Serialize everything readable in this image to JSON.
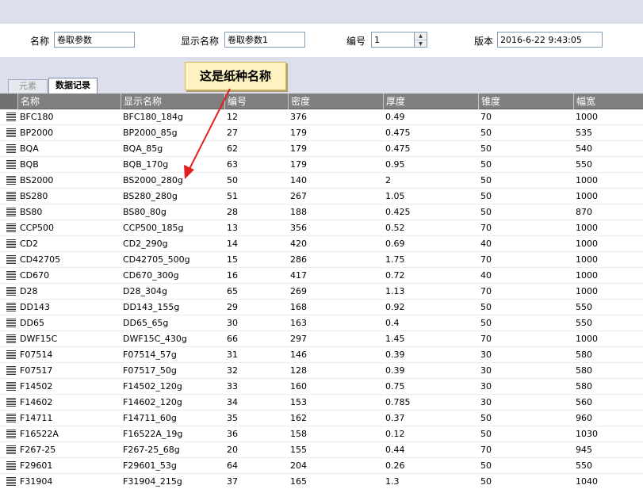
{
  "form": {
    "name_label": "名称",
    "name_value": "卷取参数",
    "display_name_label": "显示名称",
    "display_name_value": "卷取参数1",
    "number_label": "编号",
    "number_value": "1",
    "version_label": "版本",
    "version_value": "2016-6-22 9:43:05"
  },
  "tabs": [
    {
      "label": "元素"
    },
    {
      "label": "数据记录"
    }
  ],
  "callout": {
    "text": "这是纸种名称"
  },
  "grid": {
    "columns": [
      "名称",
      "显示名称",
      "编号",
      "密度",
      "厚度",
      "锥度",
      "幅宽"
    ],
    "rows": [
      {
        "cells": [
          "BFC180",
          "BFC180_184g",
          "12",
          "376",
          "0.49",
          "70",
          "1000"
        ]
      },
      {
        "cells": [
          "BP2000",
          "BP2000_85g",
          "27",
          "179",
          "0.475",
          "50",
          "535"
        ]
      },
      {
        "cells": [
          "BQA",
          "BQA_85g",
          "62",
          "179",
          "0.475",
          "50",
          "540"
        ]
      },
      {
        "cells": [
          "BQB",
          "BQB_170g",
          "63",
          "179",
          "0.95",
          "50",
          "550"
        ]
      },
      {
        "cells": [
          "BS2000",
          "BS2000_280g",
          "50",
          "140",
          "2",
          "50",
          "1000"
        ]
      },
      {
        "cells": [
          "BS280",
          "BS280_280g",
          "51",
          "267",
          "1.05",
          "50",
          "1000"
        ]
      },
      {
        "cells": [
          "BS80",
          "BS80_80g",
          "28",
          "188",
          "0.425",
          "50",
          "870"
        ]
      },
      {
        "cells": [
          "CCP500",
          "CCP500_185g",
          "13",
          "356",
          "0.52",
          "70",
          "1000"
        ]
      },
      {
        "cells": [
          "CD2",
          "CD2_290g",
          "14",
          "420",
          "0.69",
          "40",
          "1000"
        ]
      },
      {
        "cells": [
          "CD42705",
          "CD42705_500g",
          "15",
          "286",
          "1.75",
          "70",
          "1000"
        ]
      },
      {
        "cells": [
          "CD670",
          "CD670_300g",
          "16",
          "417",
          "0.72",
          "40",
          "1000"
        ]
      },
      {
        "cells": [
          "D28",
          "D28_304g",
          "65",
          "269",
          "1.13",
          "70",
          "1000"
        ]
      },
      {
        "cells": [
          "DD143",
          "DD143_155g",
          "29",
          "168",
          "0.92",
          "50",
          "550"
        ]
      },
      {
        "cells": [
          "DD65",
          "DD65_65g",
          "30",
          "163",
          "0.4",
          "50",
          "550"
        ]
      },
      {
        "cells": [
          "DWF15C",
          "DWF15C_430g",
          "66",
          "297",
          "1.45",
          "70",
          "1000"
        ]
      },
      {
        "cells": [
          "F07514",
          "F07514_57g",
          "31",
          "146",
          "0.39",
          "30",
          "580"
        ]
      },
      {
        "cells": [
          "F07517",
          "F07517_50g",
          "32",
          "128",
          "0.39",
          "30",
          "580"
        ]
      },
      {
        "cells": [
          "F14502",
          "F14502_120g",
          "33",
          "160",
          "0.75",
          "30",
          "580"
        ]
      },
      {
        "cells": [
          "F14602",
          "F14602_120g",
          "34",
          "153",
          "0.785",
          "30",
          "560"
        ]
      },
      {
        "cells": [
          "F14711",
          "F14711_60g",
          "35",
          "162",
          "0.37",
          "50",
          "960"
        ]
      },
      {
        "cells": [
          "F16522A",
          "F16522A_19g",
          "36",
          "158",
          "0.12",
          "50",
          "1030"
        ]
      },
      {
        "cells": [
          "F267-25",
          "F267-25_68g",
          "20",
          "155",
          "0.44",
          "70",
          "945"
        ]
      },
      {
        "cells": [
          "F29601",
          "F29601_53g",
          "64",
          "204",
          "0.26",
          "50",
          "550"
        ]
      },
      {
        "cells": [
          "F31904",
          "F31904_215g",
          "37",
          "165",
          "1.3",
          "50",
          "1040"
        ]
      }
    ]
  }
}
